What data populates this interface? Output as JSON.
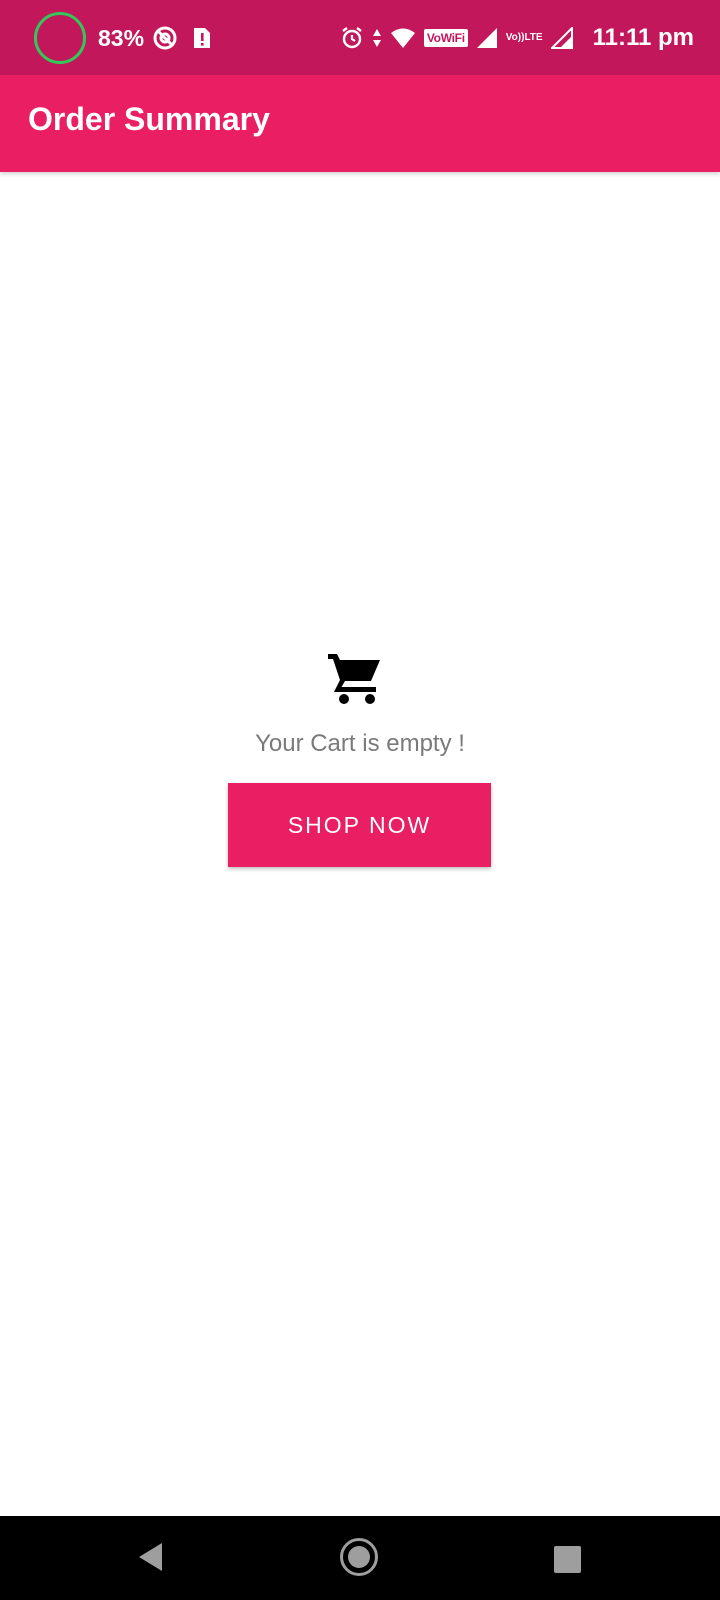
{
  "status_bar": {
    "battery_percent": "83%",
    "vowifi_label": "VoWiFi",
    "volte_top": "Vo))",
    "volte_bottom": "LTE",
    "time": "11:11 pm"
  },
  "app_bar": {
    "title": "Order Summary"
  },
  "empty_state": {
    "icon": "shopping-cart-icon",
    "message": "Your Cart is empty !",
    "button_label": "SHOP NOW"
  },
  "nav_bar": {
    "icons": [
      "back-icon",
      "home-icon",
      "recents-icon"
    ]
  },
  "colors": {
    "status_bar": "#c2185b",
    "primary": "#e91e63",
    "text_secondary": "#7a7a7a",
    "battery_ring": "#34c759"
  }
}
